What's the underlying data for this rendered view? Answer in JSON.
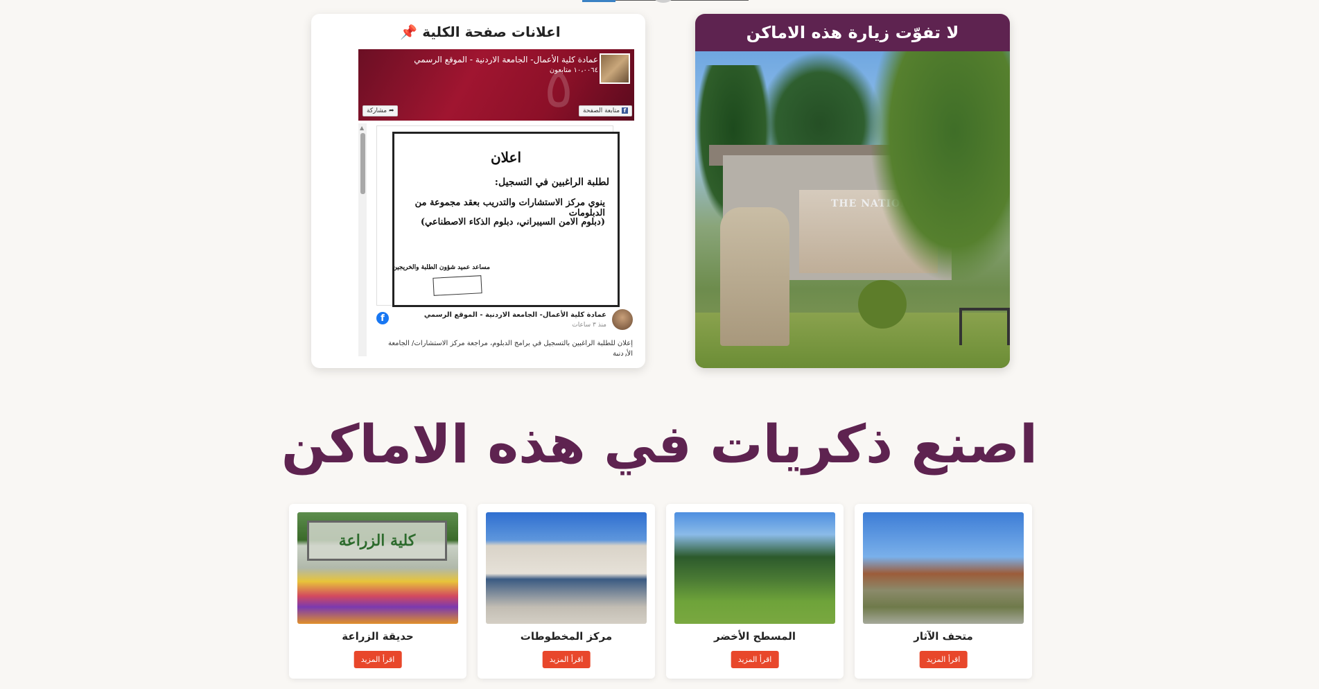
{
  "fb_widget": {
    "title": "اعلانات صفحة الكلية",
    "pin_icon": "📌",
    "page_name": "عمادة كلية الأعمال- الجامعة الاردنية - الموقع الرسمي",
    "followers": "١٠،٠٠٦٤ متابعون",
    "follow_label": "متابعة الصفحة",
    "share_label": "مشاركة",
    "post": {
      "image_title": "اعلان",
      "image_line1": "لطلبة الراغبين في التسجيل:",
      "image_line2": "ينوي مركز الاستشارات والتدريب بعقد مجموعة من الدبلومات",
      "image_line3": "(دبلوم الامن السيبراني، دبلوم الذكاء الاصطناعي)",
      "image_signature": "مساعد عميد شؤون الطلبة والخريجين",
      "author": "عمادة كلية الأعمال- الجامعة الاردنية - الموقع الرسمي",
      "time": "منذ ٣ ساعات",
      "text": "إعلان للطلبة الراغبين بالتسجيل في برامج الدبلوم، مراجعة مركز الاستشارات/ الجامعة الأردنية"
    }
  },
  "visit_card": {
    "title": "لا تفوّت زيارة هذه الاماكن",
    "sign_text": "THE NATIONAL HERITAGE"
  },
  "section_heading": "اصنع ذكريات في هذه الاماكن",
  "places": [
    {
      "name": "متحف الآثار",
      "button": "اقرأ المزيد"
    },
    {
      "name": "المسطح الأخضر",
      "button": "اقرأ المزيد"
    },
    {
      "name": "مركز المخطوطات",
      "button": "اقرأ المزيد"
    },
    {
      "name": "حديقة الزراعة",
      "button": "اقرأ المزيد",
      "sign_text": "كلية الزراعة"
    }
  ],
  "colors": {
    "brand_purple": "#5e2350",
    "button_orange": "#e8472b",
    "facebook_blue": "#1877f2"
  }
}
